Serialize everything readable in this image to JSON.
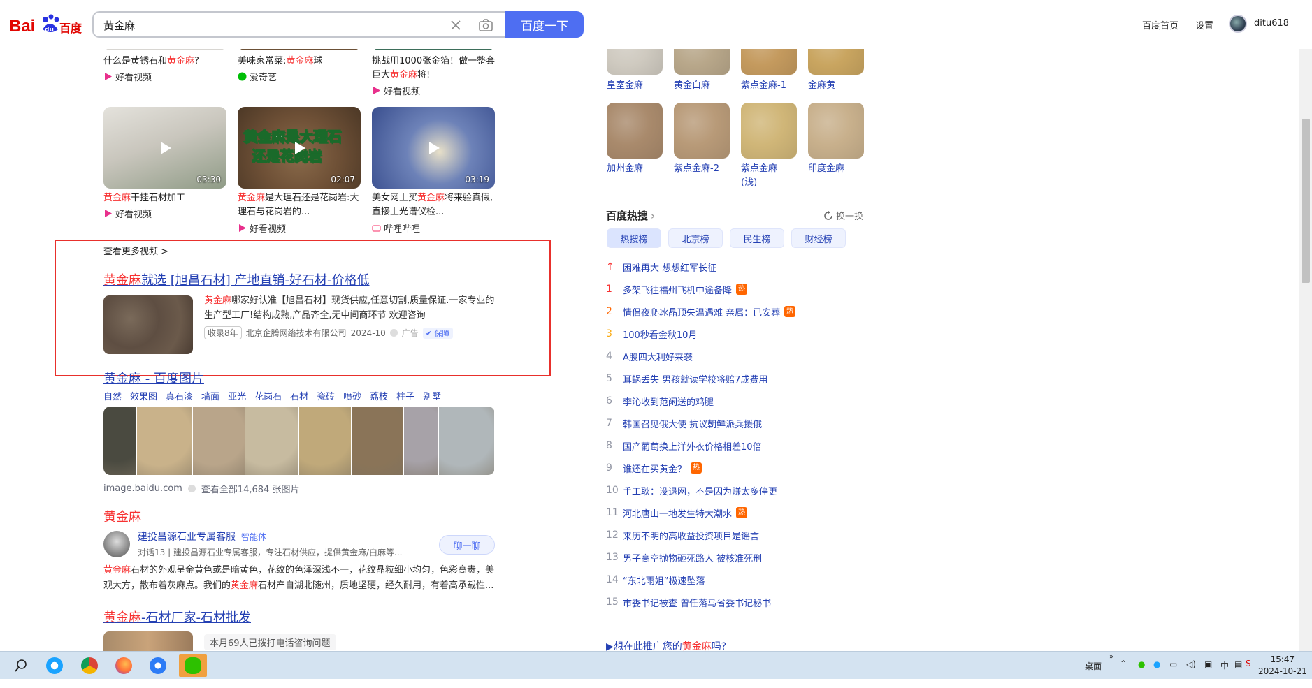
{
  "header": {
    "logo_text": "Bai百度",
    "search_value": "黄金麻",
    "search_button": "百度一下",
    "links": [
      "百度首页",
      "设置"
    ],
    "username": "ditu618"
  },
  "videos_top": [
    {
      "pre": "什么是黄锈石和",
      "hl": "黄金麻",
      "post": "?",
      "source": "好看视频"
    },
    {
      "pre": "美味家常菜:",
      "hl": "黄金麻",
      "post": "球",
      "source": "爱奇艺"
    },
    {
      "line1": "挑战用1000张金箔！做一整套",
      "pre": "巨大",
      "hl": "黄金麻",
      "post": "将!",
      "source": "好看视频"
    }
  ],
  "videos": [
    {
      "duration": "03:30",
      "hl": "黄金麻",
      "post": "干挂石材加工",
      "source": "好看视频",
      "overlay": ""
    },
    {
      "duration": "02:07",
      "hl": "黄金麻",
      "post": "是大理石还是花岗岩:大",
      "line2": "理石与花岗岩的...",
      "source": "好看视频",
      "overlay1": "黄金麻是大理石",
      "overlay2": "还是花岗岩"
    },
    {
      "duration": "03:19",
      "pre": "美女网上买",
      "hl": "黄金麻",
      "post": "将来验真假,",
      "line2": "直接上光谱仪检...",
      "source": "哔哩哔哩"
    }
  ],
  "more_videos": "查看更多视频 >",
  "ad": {
    "title_hl": "黄金麻",
    "title_rest": "就选 [旭昌石材] 产地直销-好石材-价格低",
    "desc_hl": "黄金麻",
    "desc_rest": "哪家好认准【旭昌石材】现货供应,任意切割,质量保证.一家专业的生产型工厂!结构成熟,产品齐全,无中间商环节 欢迎咨询",
    "tag": "收录8年",
    "company": "北京企腾网络技术有限公司",
    "date": "2024-10",
    "ad_label": "广告",
    "bao_label": "保障"
  },
  "images": {
    "title_hl": "黄金麻",
    "title_rest": " - 百度图片",
    "tags": [
      "自然",
      "效果图",
      "真石漆",
      "墙面",
      "亚光",
      "花岗石",
      "石材",
      "瓷砖",
      "喷砂",
      "荔枝",
      "柱子",
      "别墅"
    ],
    "source": "image.baidu.com",
    "view_all": "查看全部14,684 张图片",
    "colors": [
      "#4a4a40",
      "#c9b28a",
      "#b9a58a",
      "#c7bba0",
      "#c0a97a",
      "#8a7458",
      "#a7a2a8",
      "#b0b7ba"
    ]
  },
  "result3": {
    "title": "黄金麻",
    "agent_name": "建投昌源石业专属客服",
    "agent_tag": "智能体",
    "agent_desc": "对话13 | 建投昌源石业专属客服，专注石材供应，提供黄金麻/白麻等...",
    "chat_button": "聊一聊",
    "desc_hl1": "黄金麻",
    "desc_p1": "石材的外观呈金黄色或是暗黄色，花纹的色泽深浅不一，花纹晶粒细小均匀，色彩高贵，美观大方，散布着灰麻点。我们的",
    "desc_hl2": "黄金麻",
    "desc_p2": "石材产自湖北随州，质地坚硬，经久耐用，有着高承载性..."
  },
  "result4": {
    "title_hl": "黄金麻",
    "title_rest": "-石材厂家-石材批发",
    "note": "本月69人已拨打电话咨询问题"
  },
  "stones": [
    {
      "name": "皇室金麻",
      "color": "#cfcac0"
    },
    {
      "name": "黄金白麻",
      "color": "#b8a78a"
    },
    {
      "name": "紫点金麻-1",
      "color": "#c49a5e"
    },
    {
      "name": "金麻黄",
      "color": "#c9a560"
    },
    {
      "name": "加州金麻",
      "color": "#a98a6c"
    },
    {
      "name": "紫点金麻-2",
      "color": "#b89a78"
    },
    {
      "name": "紫点金麻\n(浅)",
      "color": "#d0b678"
    },
    {
      "name": "印度金麻",
      "color": "#c8b08c"
    }
  ],
  "hot": {
    "title": "百度热搜",
    "refresh": "换一换",
    "tabs": [
      "热搜榜",
      "北京榜",
      "民生榜",
      "财经榜"
    ],
    "items": [
      {
        "rank": "↑",
        "text": "困难再大 想想红军长征",
        "badge": ""
      },
      {
        "rank": "1",
        "text": "多架飞往福州飞机中途备降",
        "badge": "热"
      },
      {
        "rank": "2",
        "text": "情侣夜爬冰晶顶失温遇难 亲属：已安葬",
        "badge": "热"
      },
      {
        "rank": "3",
        "text": "100秒看金秋10月",
        "badge": ""
      },
      {
        "rank": "4",
        "text": "A股四大利好来袭",
        "badge": ""
      },
      {
        "rank": "5",
        "text": "耳蜗丢失 男孩就读学校将赔7成费用",
        "badge": ""
      },
      {
        "rank": "6",
        "text": "李沁收到范闲送的鸡腿",
        "badge": ""
      },
      {
        "rank": "7",
        "text": "韩国召见俄大使 抗议朝鲜派兵援俄",
        "badge": ""
      },
      {
        "rank": "8",
        "text": "国产葡萄换上洋外衣价格相差10倍",
        "badge": ""
      },
      {
        "rank": "9",
        "text": "谁还在买黄金？",
        "badge": "热"
      },
      {
        "rank": "10",
        "text": "手工耿：没退网，不是因为赚太多停更",
        "badge": ""
      },
      {
        "rank": "11",
        "text": "河北唐山一地发生特大潮水",
        "badge": "热"
      },
      {
        "rank": "12",
        "text": "来历不明的高收益投资项目是谣言",
        "badge": ""
      },
      {
        "rank": "13",
        "text": "男子高空抛物砸死路人 被核准死刑",
        "badge": ""
      },
      {
        "rank": "14",
        "text": "“东北雨姐”极速坠落",
        "badge": ""
      },
      {
        "rank": "15",
        "text": "市委书记被查 曾任落马省委书记秘书",
        "badge": ""
      }
    ]
  },
  "promo": {
    "pre": "▶想在此推广您的",
    "hl": "黄金麻",
    "post": "吗?"
  },
  "taskbar": {
    "desktop": "桌面",
    "ime": "中",
    "time": "15:47",
    "date": "2024-10-21"
  }
}
